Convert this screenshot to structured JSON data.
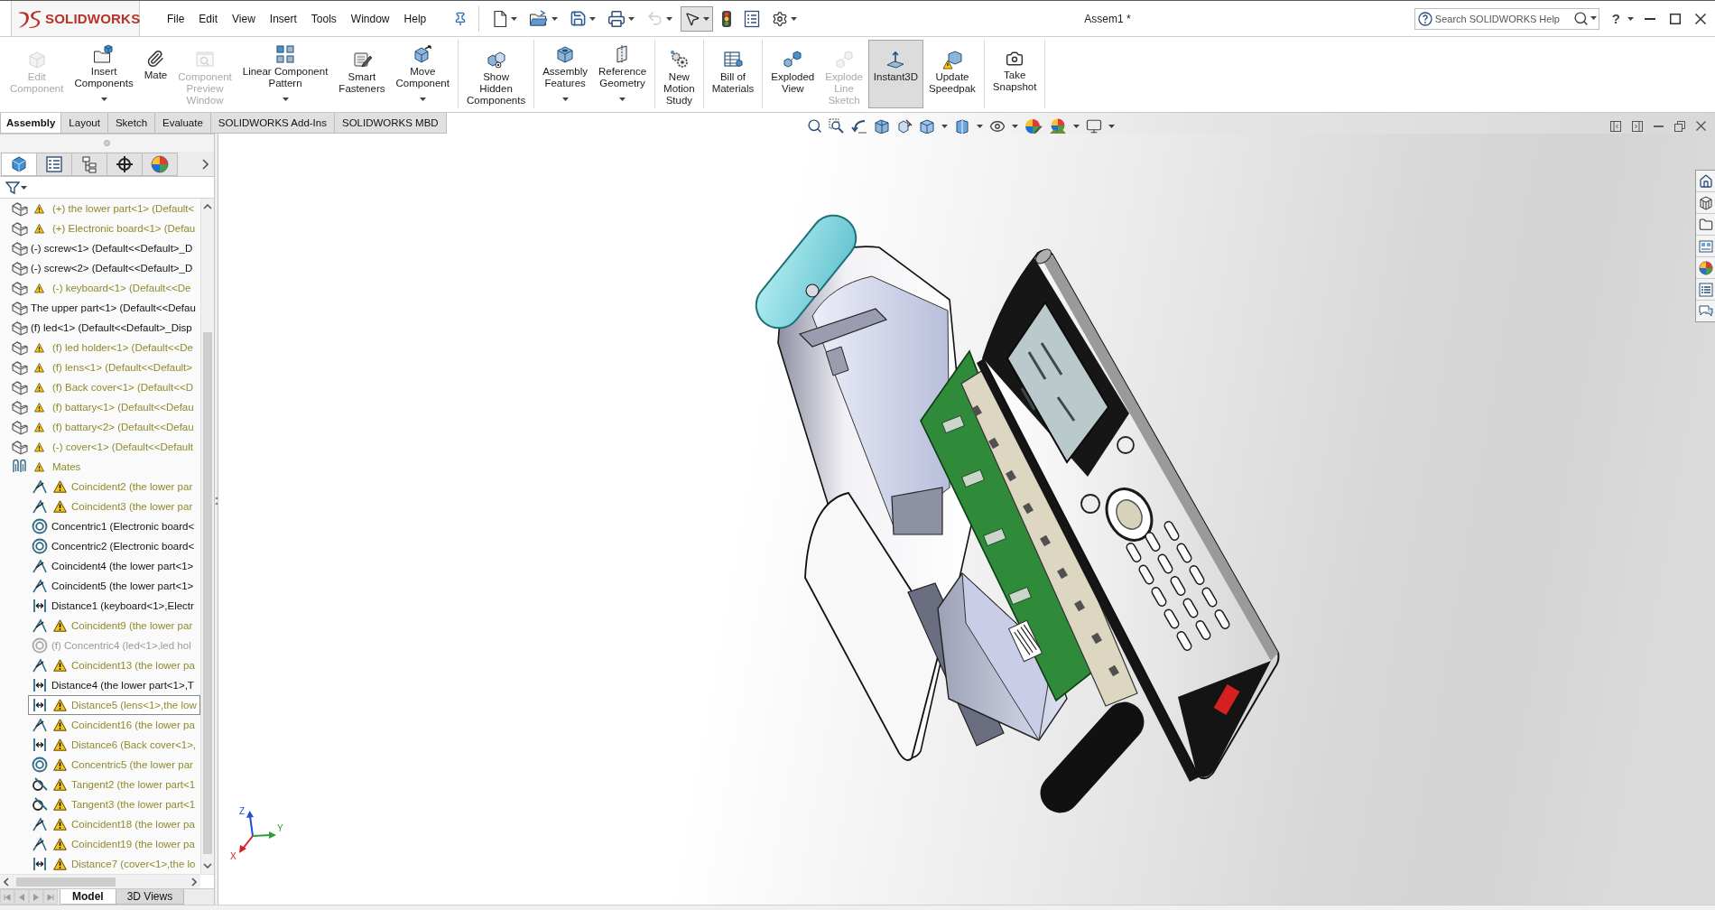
{
  "title_bar": {
    "logo": "SOLIDWORKS",
    "menu": [
      "File",
      "Edit",
      "View",
      "Insert",
      "Tools",
      "Window",
      "Help"
    ],
    "quick_access": [
      {
        "dropdown": true,
        "disabled": false,
        "active": false
      },
      {
        "dropdown": true,
        "disabled": false,
        "active": false
      },
      {
        "dropdown": true,
        "disabled": false,
        "active": false
      },
      {
        "dropdown": true,
        "disabled": false,
        "active": false
      },
      {
        "dropdown": true,
        "disabled": true,
        "active": false
      },
      {
        "dropdown": true,
        "disabled": false,
        "active": true
      },
      {
        "dropdown": false,
        "disabled": false,
        "active": false
      },
      {
        "dropdown": false,
        "disabled": false,
        "active": false
      },
      {
        "dropdown": true,
        "disabled": false,
        "active": false
      }
    ],
    "document_title": "Assem1 *",
    "search": {
      "placeholder": "Search SOLIDWORKS Help"
    },
    "help": "?"
  },
  "ribbon": {
    "groups": [
      [
        {
          "lines": [
            "Edit",
            "Component"
          ],
          "disabled": true,
          "dropdown": false,
          "selected": false
        },
        {
          "lines": [
            "Insert",
            "Components"
          ],
          "disabled": false,
          "dropdown": true,
          "selected": false
        },
        {
          "lines": [
            "Mate"
          ],
          "disabled": false,
          "dropdown": false,
          "selected": false
        },
        {
          "lines": [
            "Component",
            "Preview",
            "Window"
          ],
          "disabled": true,
          "dropdown": false,
          "selected": false
        },
        {
          "lines": [
            "Linear Component",
            "Pattern"
          ],
          "disabled": false,
          "dropdown": true,
          "selected": false
        },
        {
          "lines": [
            "Smart",
            "Fasteners"
          ],
          "disabled": false,
          "dropdown": false,
          "selected": false
        },
        {
          "lines": [
            "Move",
            "Component"
          ],
          "disabled": false,
          "dropdown": true,
          "selected": false
        }
      ],
      [
        {
          "lines": [
            "Show",
            "Hidden",
            "Components"
          ],
          "disabled": false,
          "dropdown": false,
          "selected": false
        }
      ],
      [
        {
          "lines": [
            "Assembly",
            "Features"
          ],
          "disabled": false,
          "dropdown": true,
          "selected": false
        },
        {
          "lines": [
            "Reference",
            "Geometry"
          ],
          "disabled": false,
          "dropdown": true,
          "selected": false
        }
      ],
      [
        {
          "lines": [
            "New",
            "Motion",
            "Study"
          ],
          "disabled": false,
          "dropdown": false,
          "selected": false
        }
      ],
      [
        {
          "lines": [
            "Bill of",
            "Materials"
          ],
          "disabled": false,
          "dropdown": false,
          "selected": false
        }
      ],
      [
        {
          "lines": [
            "Exploded",
            "View"
          ],
          "disabled": false,
          "dropdown": false,
          "selected": false
        },
        {
          "lines": [
            "Explode",
            "Line",
            "Sketch"
          ],
          "disabled": true,
          "dropdown": false,
          "selected": false
        },
        {
          "lines": [
            "Instant3D"
          ],
          "disabled": false,
          "dropdown": false,
          "selected": true
        },
        {
          "lines": [
            "Update",
            "Speedpak"
          ],
          "disabled": false,
          "dropdown": false,
          "selected": false
        }
      ],
      [
        {
          "lines": [
            "Take",
            "Snapshot"
          ],
          "disabled": false,
          "dropdown": false,
          "selected": false
        }
      ]
    ]
  },
  "command_tabs": [
    {
      "label": "Assembly",
      "selected": true
    },
    {
      "label": "Layout",
      "selected": false
    },
    {
      "label": "Sketch",
      "selected": false
    },
    {
      "label": "Evaluate",
      "selected": false
    },
    {
      "label": "SOLIDWORKS Add-Ins",
      "selected": false
    },
    {
      "label": "SOLIDWORKS MBD",
      "selected": false
    }
  ],
  "manager_tabs": [
    {
      "selected": true
    },
    {
      "selected": false
    },
    {
      "selected": false
    },
    {
      "selected": false
    },
    {
      "selected": false
    }
  ],
  "feature_tree": {
    "items": [
      {
        "kind": "part",
        "label": "(+) the lower part<1> (Default<",
        "warning": true,
        "selected": false
      },
      {
        "kind": "part",
        "label": "(+) Electronic board<1> (Defau",
        "warning": true,
        "selected": false
      },
      {
        "kind": "part",
        "label": "(-) screw<1> (Default<<Default>_D",
        "warning": false,
        "selected": false
      },
      {
        "kind": "part",
        "label": "(-) screw<2> (Default<<Default>_D",
        "warning": false,
        "selected": false
      },
      {
        "kind": "part",
        "label": "(-) keyboard<1> (Default<<De",
        "warning": true,
        "selected": false
      },
      {
        "kind": "part",
        "label": "The upper part<1> (Default<<Defau",
        "warning": false,
        "selected": false
      },
      {
        "kind": "part",
        "label": "(f) led<1> (Default<<Default>_Disp",
        "warning": false,
        "selected": false
      },
      {
        "kind": "part",
        "label": "(f) led holder<1> (Default<<De",
        "warning": true,
        "selected": false
      },
      {
        "kind": "part",
        "label": "(f) lens<1> (Default<<Default>",
        "warning": true,
        "selected": false
      },
      {
        "kind": "part",
        "label": "(f) Back cover<1> (Default<<D",
        "warning": true,
        "selected": false
      },
      {
        "kind": "part",
        "label": "(f) battary<1> (Default<<Defau",
        "warning": true,
        "selected": false
      },
      {
        "kind": "part",
        "label": "(f) battary<2> (Default<<Defau",
        "warning": true,
        "selected": false
      },
      {
        "kind": "part",
        "label": "(-) cover<1> (Default<<Default",
        "warning": true,
        "selected": false
      },
      {
        "kind": "mates",
        "label": "Mates",
        "warning": true,
        "selected": false,
        "children": [
          {
            "kind": "coincident",
            "label": "Coincident2 (the lower par",
            "warning": true,
            "suppressed": false,
            "selected": false
          },
          {
            "kind": "coincident",
            "label": "Coincident3 (the lower par",
            "warning": true,
            "suppressed": false,
            "selected": false
          },
          {
            "kind": "concentric",
            "label": "Concentric1 (Electronic board<",
            "warning": false,
            "suppressed": false,
            "selected": false
          },
          {
            "kind": "concentric",
            "label": "Concentric2 (Electronic board<",
            "warning": false,
            "suppressed": false,
            "selected": false
          },
          {
            "kind": "coincident",
            "label": "Coincident4 (the lower part<1>",
            "warning": false,
            "suppressed": false,
            "selected": false
          },
          {
            "kind": "coincident",
            "label": "Coincident5 (the lower part<1>",
            "warning": false,
            "suppressed": false,
            "selected": false
          },
          {
            "kind": "distance",
            "label": "Distance1 (keyboard<1>,Electr",
            "warning": false,
            "suppressed": false,
            "selected": false
          },
          {
            "kind": "coincident",
            "label": "Coincident9 (the lower par",
            "warning": true,
            "suppressed": false,
            "selected": false
          },
          {
            "kind": "concentric",
            "label": "(f) Concentric4 (led<1>,led hol",
            "warning": false,
            "suppressed": true,
            "selected": false
          },
          {
            "kind": "coincident",
            "label": "Coincident13 (the lower pa",
            "warning": true,
            "suppressed": false,
            "selected": false
          },
          {
            "kind": "distance",
            "label": "Distance4 (the lower part<1>,T",
            "warning": false,
            "suppressed": false,
            "selected": false
          },
          {
            "kind": "distance",
            "label": "Distance5 (lens<1>,the low",
            "warning": true,
            "suppressed": false,
            "selected": true
          },
          {
            "kind": "coincident",
            "label": "Coincident16 (the lower pa",
            "warning": true,
            "suppressed": false,
            "selected": false
          },
          {
            "kind": "distance",
            "label": "Distance6 (Back cover<1>,",
            "warning": true,
            "suppressed": false,
            "selected": false
          },
          {
            "kind": "concentric",
            "label": "Concentric5 (the lower par",
            "warning": true,
            "suppressed": false,
            "selected": false
          },
          {
            "kind": "tangent",
            "label": "Tangent2 (the lower part<1",
            "warning": true,
            "suppressed": false,
            "selected": false
          },
          {
            "kind": "tangent",
            "label": "Tangent3 (the lower part<1",
            "warning": true,
            "suppressed": false,
            "selected": false
          },
          {
            "kind": "coincident",
            "label": "Coincident18 (the lower pa",
            "warning": true,
            "suppressed": false,
            "selected": false
          },
          {
            "kind": "coincident",
            "label": "Coincident19 (the lower pa",
            "warning": true,
            "suppressed": false,
            "selected": false
          },
          {
            "kind": "distance",
            "label": "Distance7 (cover<1>,the lo",
            "warning": true,
            "suppressed": false,
            "selected": false
          }
        ]
      }
    ]
  },
  "panel_tabs": [
    {
      "label": "Model",
      "selected": true
    },
    {
      "label": "3D Views",
      "selected": false
    }
  ],
  "triad": {
    "x": "X",
    "y": "Y",
    "z": "Z"
  }
}
